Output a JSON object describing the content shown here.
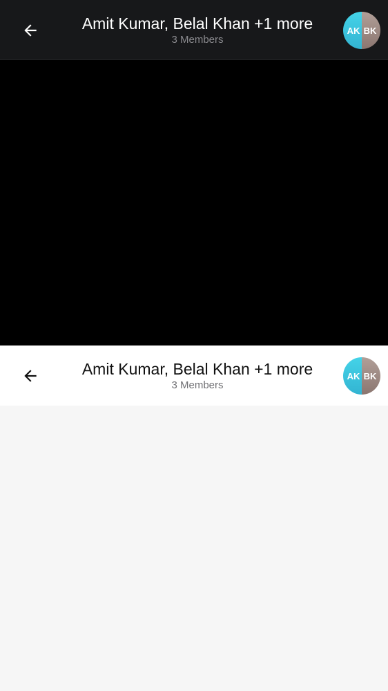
{
  "dark_header": {
    "title": "Amit Kumar, Belal Khan +1 more",
    "subtitle": "3 Members",
    "back_icon": "arrow-left-icon",
    "avatar": {
      "left_initials": "AK",
      "right_initials": "BK",
      "left_color": "#3fc6e0",
      "right_color": "#a08c85"
    }
  },
  "light_header": {
    "title": "Amit Kumar, Belal Khan +1 more",
    "subtitle": "3 Members",
    "back_icon": "arrow-left-icon",
    "avatar": {
      "left_initials": "AK",
      "right_initials": "BK",
      "left_color": "#3fc6e0",
      "right_color": "#a08c85"
    }
  },
  "colors": {
    "dark_background": "#000000",
    "dark_header_background": "#17181a",
    "light_header_background": "#ffffff",
    "content_background": "#f6f6f6"
  }
}
